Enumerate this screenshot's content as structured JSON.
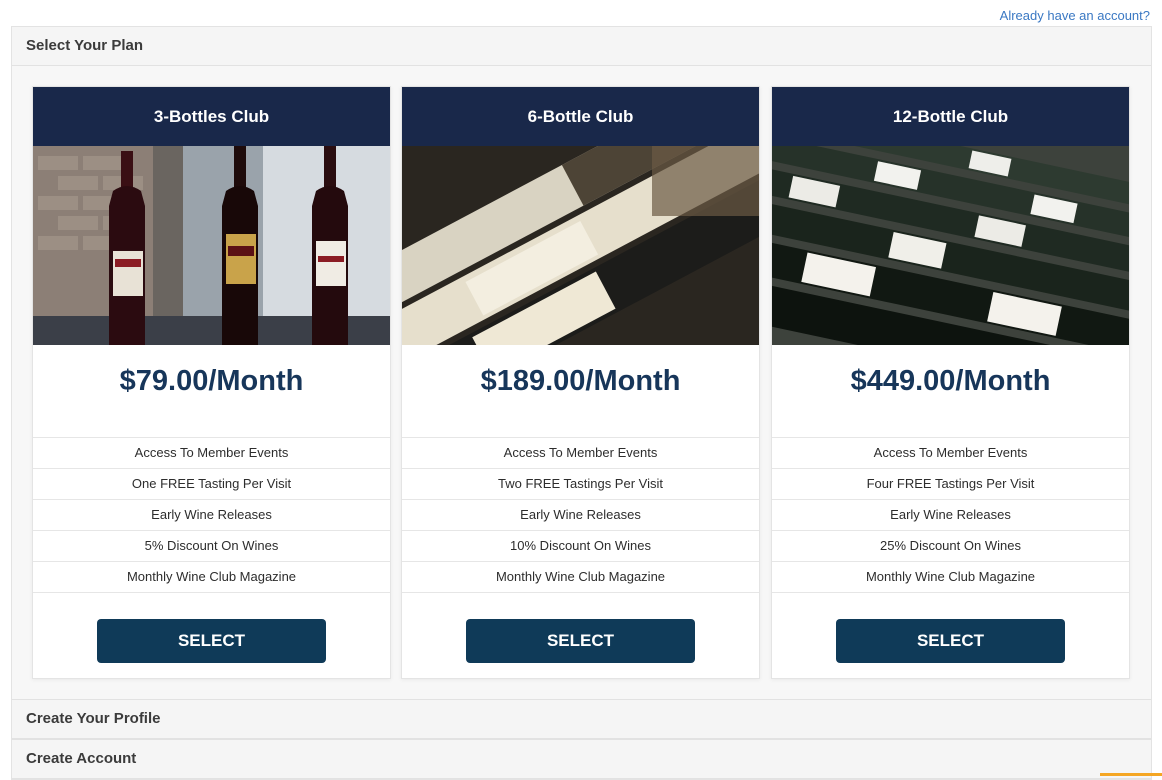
{
  "header": {
    "already_account_link": "Already have an account?"
  },
  "sections": {
    "select_plan": "Select Your Plan",
    "create_profile": "Create Your Profile",
    "create_account": "Create Account"
  },
  "plans": [
    {
      "title": "3-Bottles Club",
      "price": "$79.00/Month",
      "features": [
        "Access To Member Events",
        "One FREE Tasting Per Visit",
        "Early Wine Releases",
        "5% Discount On Wines",
        "Monthly Wine Club Magazine"
      ],
      "button": "SELECT"
    },
    {
      "title": "6-Bottle Club",
      "price": "$189.00/Month",
      "features": [
        "Access To Member Events",
        "Two FREE Tastings Per Visit",
        "Early Wine Releases",
        "10% Discount On Wines",
        "Monthly Wine Club Magazine"
      ],
      "button": "SELECT"
    },
    {
      "title": "12-Bottle Club",
      "price": "$449.00/Month",
      "features": [
        "Access To Member Events",
        "Four FREE Tastings Per Visit",
        "Early Wine Releases",
        "25% Discount On Wines",
        "Monthly Wine Club Magazine"
      ],
      "button": "SELECT"
    }
  ],
  "colors": {
    "header_navy": "#19284a",
    "price_text": "#17365a",
    "button": "#0f3a58",
    "link": "#3a78c3"
  }
}
